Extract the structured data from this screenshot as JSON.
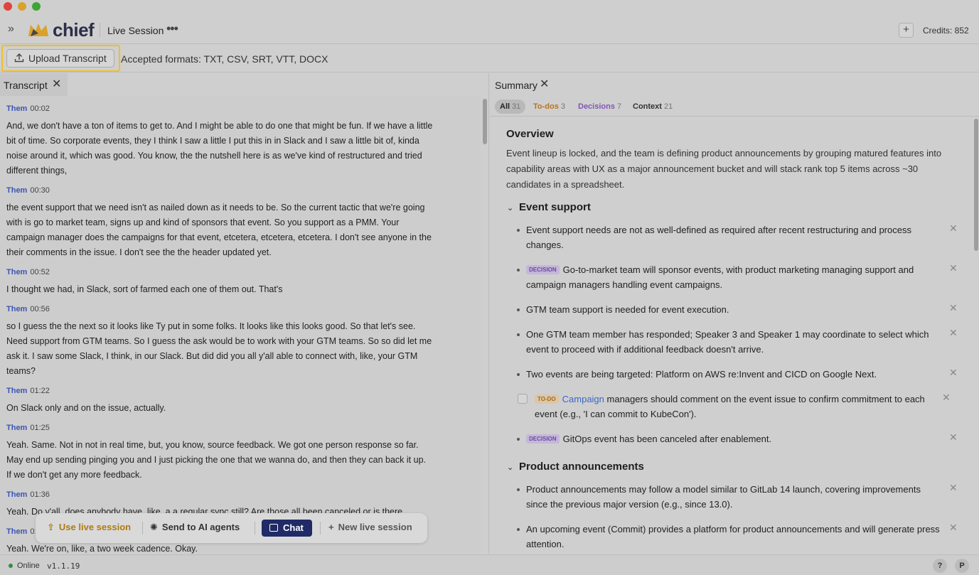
{
  "app": {
    "logo_text": "chief",
    "session_title": "Live Session",
    "credits": "Credits: 852",
    "colors": {
      "accent_navy": "#1f2a66",
      "logo_gold": "#d9a22a",
      "highlight": "#f0c020"
    }
  },
  "upload": {
    "button_label": "Upload Transcript",
    "formats": "Accepted formats: TXT, CSV, SRT, VTT, DOCX"
  },
  "transcript": {
    "tab_label": "Transcript",
    "entries": [
      {
        "speaker": "Them",
        "time": "00:02",
        "text": "And, we don't have a ton of items to get to. And I might be able to do one that might be fun. If we have a little bit of time. So corporate events, they I think I saw a little I put this in in Slack and I saw a little bit of, kinda noise around it, which was good. You know, the the nutshell here is as we've kind of restructured and tried different things,"
      },
      {
        "speaker": "Them",
        "time": "00:30",
        "text": "the event support that we need isn't as nailed down as it needs to be. So the current tactic that we're going with is go to market team, signs up and kind of sponsors that event. So you support as a PMM. Your campaign manager does the campaigns for that event, etcetera, etcetera, etcetera. I don't see anyone in the their comments in the issue. I don't see the the header updated yet."
      },
      {
        "speaker": "Them",
        "time": "00:52",
        "text": "I thought we had, in Slack, sort of farmed each one of them out. That's"
      },
      {
        "speaker": "Them",
        "time": "00:56",
        "text": "so I guess the the next so it looks like Ty put in some folks. It looks like this looks good. So that let's see. Need support from GTM teams. So I guess the ask would be to work with your GTM teams. So so did let me ask it. I saw some Slack, I think, in our Slack. But did did you all y'all able to connect with, like, your GTM teams?"
      },
      {
        "speaker": "Them",
        "time": "01:22",
        "text": "On Slack only and on the issue, actually."
      },
      {
        "speaker": "Them",
        "time": "01:25",
        "text": "Yeah. Same. Not in not in real time, but, you know, source feedback. We got one person response so far. May end up sending pinging you and I just picking the one that we wanna do, and then they can back it up. If we don't get any more feedback."
      },
      {
        "speaker": "Them",
        "time": "01:36",
        "text": "Yeah. Do y'all, does anybody have, like, a a regular sync still? Are those all been canceled or is there"
      },
      {
        "speaker": "Them",
        "time": "01:49",
        "text": "Yeah. We're on, like, a two week cadence. Okay."
      }
    ]
  },
  "toolbar": {
    "use_live": "Use live session",
    "send_agents": "Send to AI agents",
    "chat": "Chat",
    "new_live": "New live session"
  },
  "summary": {
    "tab_label": "Summary",
    "filters": [
      {
        "label": "All",
        "count": "31"
      },
      {
        "label": "To-dos",
        "count": "3"
      },
      {
        "label": "Decisions",
        "count": "7"
      },
      {
        "label": "Context",
        "count": "21"
      }
    ],
    "overview_title": "Overview",
    "overview_text": "Event lineup is locked, and the team is defining product announcements by grouping matured features into capability areas with UX as a major announcement bucket and will stack rank top 5 items across ~30 candidates in a spreadsheet.",
    "sections": [
      {
        "title": "Event support",
        "items": [
          {
            "badge": "",
            "text": "Event support needs are not as well-defined as required after recent restructuring and process changes."
          },
          {
            "badge": "DECISION",
            "text": "Go-to-market team will sponsor events, with product marketing managing support and campaign managers handling event campaigns."
          },
          {
            "badge": "",
            "text": "GTM team support is needed for event execution."
          },
          {
            "badge": "",
            "text": "One GTM team member has responded; Speaker 3 and Speaker 1 may coordinate to select which event to proceed with if additional feedback doesn't arrive."
          },
          {
            "badge": "",
            "text": "Two events are being targeted: Platform on AWS re:Invent and CICD on Google Next."
          },
          {
            "badge": "TO-DO",
            "link": "Campaign",
            "text": " managers should comment on the event issue to confirm commitment to each event (e.g., 'I can commit to KubeCon')."
          },
          {
            "badge": "DECISION",
            "text": "GitOps event has been canceled after enablement."
          }
        ]
      },
      {
        "title": "Product announcements",
        "items": [
          {
            "badge": "",
            "text": "Product announcements may follow a model similar to GitLab 14 launch, covering improvements since the previous major version (e.g., since 13.0)."
          },
          {
            "badge": "",
            "text": "An upcoming event (Commit) provides a platform for product announcements and will generate press attention."
          }
        ]
      }
    ]
  },
  "status": {
    "online": "Online",
    "version": "v1.1.19",
    "help": "?",
    "profile": "P"
  }
}
